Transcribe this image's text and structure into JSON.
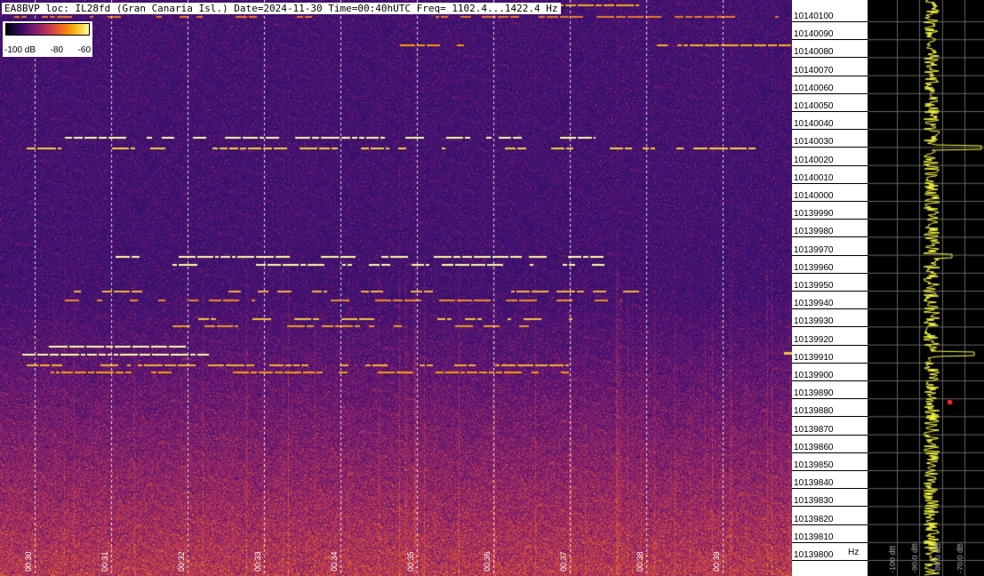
{
  "header": {
    "title": "EA8BVP loc: IL28fd (Gran Canaria Isl.) Date=2024-11-30 Time=00:40hUTC Freq= 1102.4...1422.4 Hz"
  },
  "legend": {
    "ticks": [
      "-100 dB",
      "-80",
      "-60"
    ]
  },
  "time_axis": [
    "00:30",
    "00:31",
    "00:32",
    "00:33",
    "00:34",
    "00:35",
    "00:36",
    "00:37",
    "00:38",
    "00:39"
  ],
  "freq_axis": {
    "labels": [
      "10140100",
      "10140090",
      "10140080",
      "10140070",
      "10140060",
      "10140050",
      "10140040",
      "10140030",
      "10140020",
      "10140010",
      "10140000",
      "10139990",
      "10139980",
      "10139970",
      "10139960",
      "10139950",
      "10139940",
      "10139930",
      "10139920",
      "10139910",
      "10139900",
      "10139890",
      "10139880",
      "10139870",
      "10139860",
      "10139850",
      "10139840",
      "10139830",
      "10139820",
      "10139810",
      "10139800"
    ],
    "unit": "Hz"
  },
  "spectrum_axis": [
    "-100 dB",
    "-90.0 dB",
    "-80.0 dB",
    "-70.0 dB"
  ],
  "colors": {
    "background": "#2a1466",
    "signal": "#fb9a06",
    "peak": "#fcffa4",
    "spectrum_trace": "#ffff44",
    "grid": "#ffffff"
  }
}
